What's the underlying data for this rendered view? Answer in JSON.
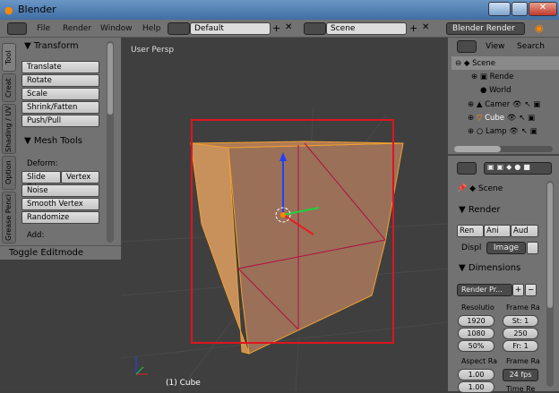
{
  "window": {
    "title": "Blender"
  },
  "menubar": {
    "items": [
      "File",
      "Render",
      "Window",
      "Help"
    ],
    "layout": "Default",
    "scene": "Scene",
    "engine": "Blender Render"
  },
  "left_panel": {
    "tabs": [
      "Tool",
      "Creat",
      "Shading / UV",
      "Option",
      "Grease Penci"
    ],
    "transform": {
      "title": "Transform",
      "buttons": [
        "Translate",
        "Rotate",
        "Scale",
        "Shrink/Fatten",
        "Push/Pull"
      ]
    },
    "mesh_tools": {
      "title": "Mesh Tools",
      "deform_label": "Deform:",
      "row": [
        "Slide Edg",
        "Vertex"
      ],
      "buttons": [
        "Noise",
        "Smooth Vertex",
        "Randomize"
      ],
      "add_label": "Add:"
    },
    "toggle": "Toggle Editmode"
  },
  "viewport": {
    "label": "User Persp",
    "object": "(1) Cube",
    "highlight_color": "#e0141e",
    "cube_color": "#c88a55"
  },
  "outliner": {
    "view": "View",
    "search": "Search",
    "items": [
      "Scene",
      "Rende",
      "World",
      "Camer",
      "Cube",
      "Lamp"
    ]
  },
  "properties": {
    "scene": "Scene",
    "render": {
      "title": "Render",
      "buttons": [
        "Ren",
        "Ani",
        "Aud"
      ],
      "display_label": "Displ",
      "display_value": "Image"
    },
    "dimensions": {
      "title": "Dimensions",
      "preset": "Render Pr...",
      "resolution_label": "Resolutio",
      "res_x": "1920",
      "res_y": "1080",
      "res_pct": "50%",
      "frame_range_label": "Frame Ra",
      "start": "St: 1",
      "end": "250",
      "step": "Fr: 1",
      "aspect_label": "Aspect Ra",
      "aspect_x": "1.00",
      "aspect_y": "1.00",
      "frame_rate_label": "Frame Ra",
      "fps": "24 fps",
      "time_label": "Time Re"
    }
  }
}
